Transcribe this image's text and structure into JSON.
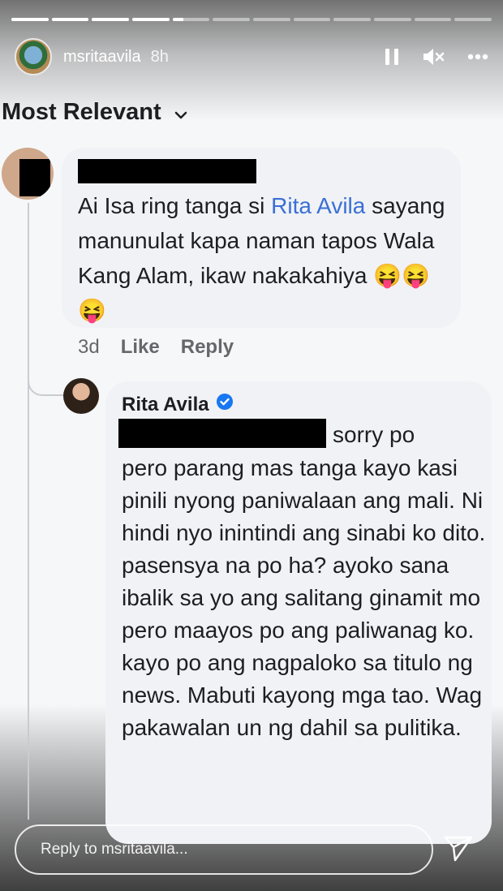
{
  "story": {
    "username": "msritaavila",
    "time": "8h",
    "progress_segments_total": 12,
    "progress_completed": 4,
    "progress_current_fraction": 0.3
  },
  "comments": {
    "sort_label": "Most Relevant",
    "first": {
      "mention": "Rita Avila",
      "text_before": "Ai Isa ring tanga si ",
      "text_after": " sayang manunulat kapa naman tapos Wala Kang Alam, ikaw nakakahiya 😝😝😝",
      "time": "3d",
      "like": "Like",
      "reply": "Reply"
    },
    "reply": {
      "author": "Rita Avila",
      "first_line": "sorry po",
      "text": "pero parang mas tanga kayo kasi pinili nyong paniwalaan ang mali. Ni hindi nyo inintindi ang sinabi ko dito. pasensya na po ha? ayoko sana ibalik sa yo ang salitang ginamit mo pero maayos po ang paliwanag ko. kayo po ang nagpaloko sa titulo ng news. Mabuti kayong mga tao. Wag pakawalan un ng dahil sa pulitika."
    }
  },
  "reply_bar": {
    "placeholder": "Reply to msritaavila..."
  },
  "icons": {
    "pause": "pause-icon",
    "mute": "mute-icon",
    "more": "more-icon",
    "send": "send-icon",
    "verified": "verified-badge-icon"
  },
  "colors": {
    "mention": "#3b6fd6",
    "verified": "#1877f2",
    "bubble": "#f0f2f5"
  }
}
